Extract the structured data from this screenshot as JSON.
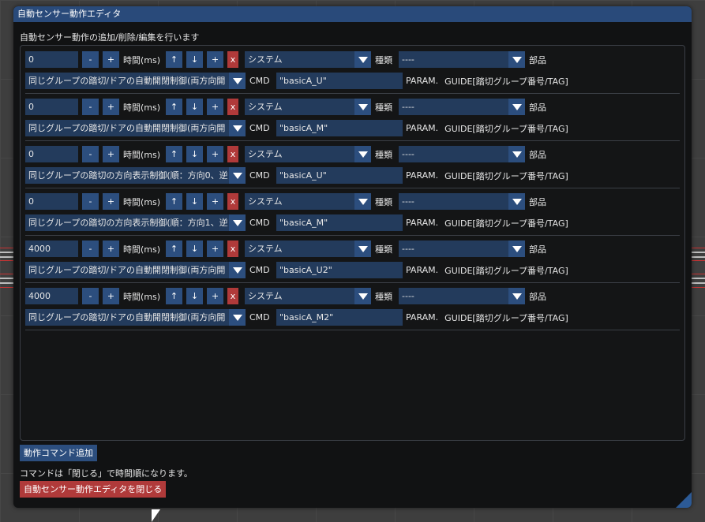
{
  "window": {
    "title": "自動センサー動作エディタ",
    "description": "自動センサー動作の追加/削除/編集を行います"
  },
  "labels": {
    "minus": "-",
    "plus": "+",
    "time": "時間(ms)",
    "up": "↑",
    "down": "↓",
    "delete": "x",
    "kind": "種類",
    "part": "部品",
    "cmd": "CMD",
    "param": "PARAM.",
    "guide": "GUIDE[踏切グループ番号/TAG]"
  },
  "commands": [
    {
      "time": "0",
      "system": "システム",
      "kind": "----",
      "desc": "同じグループの踏切/ドアの自動開閉制御(両方向開",
      "cmd": "\"basicA_U\""
    },
    {
      "time": "0",
      "system": "システム",
      "kind": "----",
      "desc": "同じグループの踏切/ドアの自動開閉制御(両方向開",
      "cmd": "\"basicA_M\""
    },
    {
      "time": "0",
      "system": "システム",
      "kind": "----",
      "desc": "同じグループの踏切の方向表示制御(順：方向0、逆",
      "cmd": "\"basicA_U\""
    },
    {
      "time": "0",
      "system": "システム",
      "kind": "----",
      "desc": "同じグループの踏切の方向表示制御(順：方向1、逆",
      "cmd": "\"basicA_M\""
    },
    {
      "time": "4000",
      "system": "システム",
      "kind": "----",
      "desc": "同じグループの踏切/ドアの自動開閉制御(両方向開",
      "cmd": "\"basicA_U2\""
    },
    {
      "time": "4000",
      "system": "システム",
      "kind": "----",
      "desc": "同じグループの踏切/ドアの自動開閉制御(両方向開",
      "cmd": "\"basicA_M2\""
    }
  ],
  "footer": {
    "add_button": "動作コマンド追加",
    "note": "コマンドは「閉じる」で時間順になります。",
    "close_button": "自動センサー動作エディタを閉じる"
  }
}
